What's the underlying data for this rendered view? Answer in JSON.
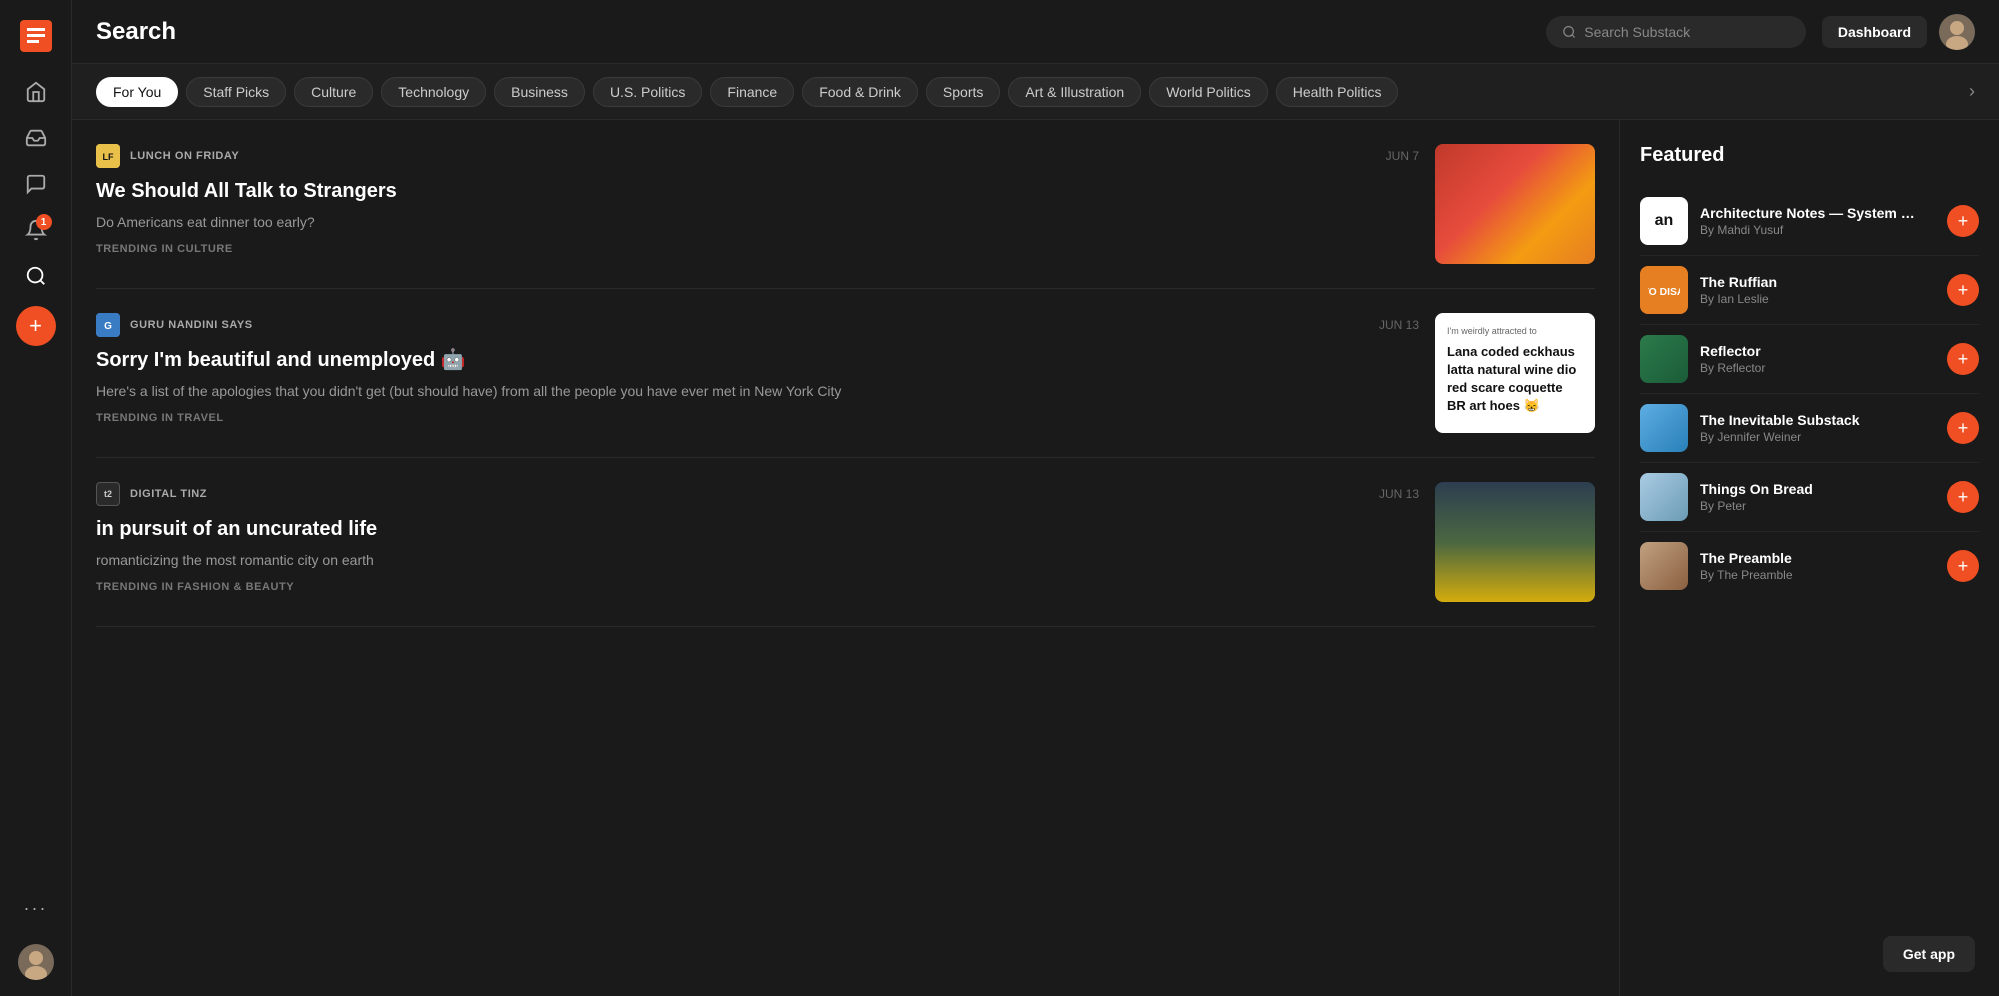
{
  "header": {
    "title": "Search",
    "search_placeholder": "Search Substack",
    "dashboard_label": "Dashboard"
  },
  "tabs": [
    {
      "id": "for-you",
      "label": "For You",
      "active": true
    },
    {
      "id": "staff-picks",
      "label": "Staff Picks",
      "active": false
    },
    {
      "id": "culture",
      "label": "Culture",
      "active": false
    },
    {
      "id": "technology",
      "label": "Technology",
      "active": false
    },
    {
      "id": "business",
      "label": "Business",
      "active": false
    },
    {
      "id": "us-politics",
      "label": "U.S. Politics",
      "active": false
    },
    {
      "id": "finance",
      "label": "Finance",
      "active": false
    },
    {
      "id": "food-drink",
      "label": "Food & Drink",
      "active": false
    },
    {
      "id": "sports",
      "label": "Sports",
      "active": false
    },
    {
      "id": "art-illustration",
      "label": "Art & Illustration",
      "active": false
    },
    {
      "id": "world-politics",
      "label": "World Politics",
      "active": false
    },
    {
      "id": "health-politics",
      "label": "Health Politics",
      "active": false
    }
  ],
  "feed": {
    "items": [
      {
        "source": "LUNCH ON FRIDAY",
        "date": "JUN 7",
        "title": "We Should All Talk to Strangers",
        "description": "Do Americans eat dinner too early?",
        "tag": "TRENDING IN CULTURE",
        "img_type": "food"
      },
      {
        "source": "GURU NANDINI SAYS",
        "date": "JUN 13",
        "title": "Sorry I'm beautiful and unemployed 🤖",
        "description": "Here's a list of the apologies that you didn't get (but should have) from all the people you have ever met in New York City",
        "tag": "TRENDING IN TRAVEL",
        "img_type": "text-card",
        "img_text": "I'm weirdly attracted to\nLana coded eckhaus latta natural wine dio red scare coquette BR art hoes 😸"
      },
      {
        "source": "DIGITAL TINZ",
        "date": "JUN 13",
        "title": "in pursuit of an uncurated life",
        "description": "romanticizing the most romantic city on earth",
        "tag": "TRENDING IN FASHION & BEAUTY",
        "img_type": "table"
      }
    ]
  },
  "featured": {
    "title": "Featured",
    "items": [
      {
        "id": "architecture-notes",
        "name": "Architecture Notes — System Design & ...",
        "by": "By Mahdi Yusuf",
        "thumb_label": "an",
        "thumb_style": "thumb-an"
      },
      {
        "id": "the-ruffian",
        "name": "The Ruffian",
        "by": "By Ian Leslie",
        "thumb_label": "",
        "thumb_style": "thumb-ruffian"
      },
      {
        "id": "reflector",
        "name": "Reflector",
        "by": "By Reflector",
        "thumb_label": "",
        "thumb_style": "thumb-reflector"
      },
      {
        "id": "inevitable-substack",
        "name": "The Inevitable Substack",
        "by": "By Jennifer Weiner",
        "thumb_label": "",
        "thumb_style": "thumb-inevitable"
      },
      {
        "id": "things-on-bread",
        "name": "Things On Bread",
        "by": "By Peter",
        "thumb_label": "",
        "thumb_style": "thumb-bread"
      },
      {
        "id": "the-preamble",
        "name": "The Preamble",
        "by": "By The Preamble",
        "thumb_label": "",
        "thumb_style": "thumb-preamble"
      }
    ]
  },
  "sidebar": {
    "nav": [
      {
        "id": "home",
        "icon": "⌂",
        "label": "home-icon"
      },
      {
        "id": "inbox",
        "icon": "📥",
        "label": "inbox-icon"
      },
      {
        "id": "chat",
        "icon": "💬",
        "label": "chat-icon"
      },
      {
        "id": "notifications",
        "icon": "🔔",
        "label": "notifications-icon",
        "badge": "1"
      },
      {
        "id": "search",
        "icon": "🔍",
        "label": "search-icon"
      },
      {
        "id": "more",
        "icon": "···",
        "label": "more-icon"
      }
    ]
  },
  "get_app_label": "Get app"
}
